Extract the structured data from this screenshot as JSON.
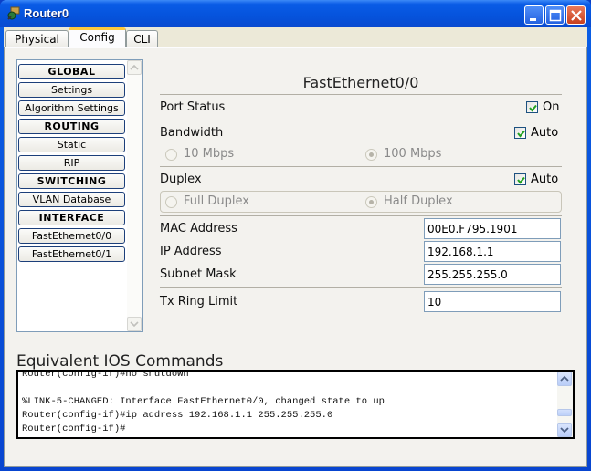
{
  "window": {
    "title": "Router0",
    "controls": [
      "minimize",
      "maximize",
      "close"
    ]
  },
  "tabs": [
    {
      "label": "Physical",
      "active": false
    },
    {
      "label": "Config",
      "active": true
    },
    {
      "label": "CLI",
      "active": false
    }
  ],
  "sidebar": {
    "items": [
      {
        "label": "GLOBAL",
        "type": "header"
      },
      {
        "label": "Settings",
        "type": "item"
      },
      {
        "label": "Algorithm Settings",
        "type": "item"
      },
      {
        "label": "ROUTING",
        "type": "header"
      },
      {
        "label": "Static",
        "type": "item"
      },
      {
        "label": "RIP",
        "type": "item"
      },
      {
        "label": "SWITCHING",
        "type": "header"
      },
      {
        "label": "VLAN Database",
        "type": "item"
      },
      {
        "label": "INTERFACE",
        "type": "header"
      },
      {
        "label": "FastEthernet0/0",
        "type": "item"
      },
      {
        "label": "FastEthernet0/1",
        "type": "item"
      }
    ]
  },
  "interface": {
    "title": "FastEthernet0/0",
    "port_status": {
      "label": "Port Status",
      "checkbox_label": "On",
      "checked": true
    },
    "bandwidth": {
      "label": "Bandwidth",
      "checkbox_label": "Auto",
      "checked": true,
      "options": [
        {
          "label": "10 Mbps",
          "selected": false
        },
        {
          "label": "100 Mbps",
          "selected": true
        }
      ]
    },
    "duplex": {
      "label": "Duplex",
      "checkbox_label": "Auto",
      "checked": true,
      "options": [
        {
          "label": "Full Duplex",
          "selected": false
        },
        {
          "label": "Half Duplex",
          "selected": true
        }
      ]
    },
    "mac_address": {
      "label": "MAC Address",
      "value": "00E0.F795.1901"
    },
    "ip_address": {
      "label": "IP Address",
      "value": "192.168.1.1"
    },
    "subnet_mask": {
      "label": "Subnet Mask",
      "value": "255.255.255.0"
    },
    "tx_ring_limit": {
      "label": "Tx Ring Limit",
      "value": "10"
    }
  },
  "ios": {
    "title": "Equivalent IOS Commands",
    "lines": [
      "Router(config-if)#no shutdown",
      "",
      "%LINK-5-CHANGED: Interface FastEthernet0/0, changed state to up",
      "Router(config-if)#ip address 192.168.1.1 255.255.255.0",
      "Router(config-if)#"
    ]
  },
  "colors": {
    "titlebar": "#0553dc",
    "active_tab_accent": "#ffc83c",
    "checkmark": "#21a121",
    "close_button": "#c8401e"
  }
}
